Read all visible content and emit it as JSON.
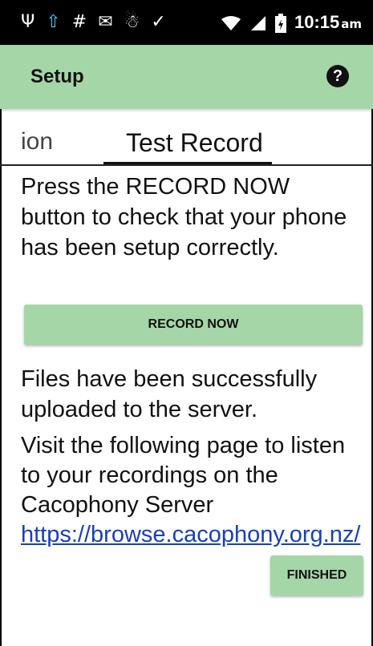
{
  "status_bar": {
    "icons": [
      {
        "name": "usb-icon",
        "glyph": "Ψ"
      },
      {
        "name": "upload-icon",
        "glyph": "⇧"
      },
      {
        "name": "hash-icon",
        "glyph": "#"
      },
      {
        "name": "mail-icon",
        "glyph": "✉"
      },
      {
        "name": "bug-icon",
        "glyph": "☃"
      },
      {
        "name": "check-icon",
        "glyph": "✓"
      }
    ],
    "time": "10:15",
    "ampm": "am"
  },
  "app_bar": {
    "title": "Setup",
    "help_glyph": "?"
  },
  "tabs": {
    "previous_tab_label": "ion",
    "active_tab_label": "Test Record"
  },
  "content": {
    "instructions": "Press the RECORD NOW button to check that your phone has been setup correctly.",
    "record_button_label": "RECORD NOW",
    "upload_status": "Files have been successfully uploaded to the server.",
    "visit_text": "Visit the following page to listen to your recordings on the Cacophony Server ",
    "server_link": "https://browse.cacophony.org.nz/",
    "finished_button_label": "FINISHED"
  },
  "colors": {
    "accent_green": "#a5d6a7",
    "link_blue": "#1a3fb5"
  }
}
